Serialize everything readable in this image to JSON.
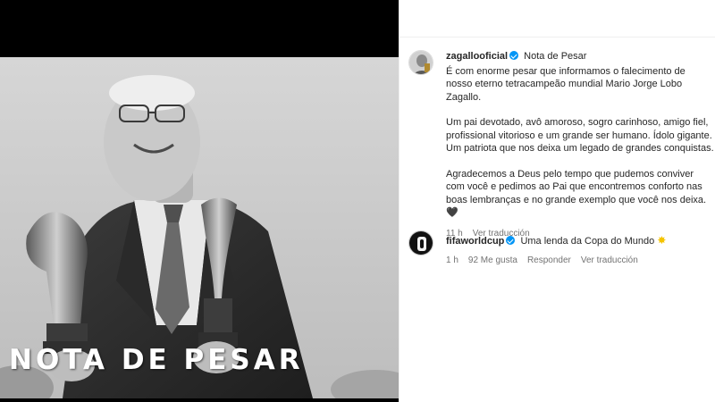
{
  "media": {
    "overlay_text": "NOTA DE PESAR"
  },
  "post": {
    "author": "zagallooficial",
    "title": "Nota de Pesar",
    "paragraphs": [
      "É com enorme pesar que informamos o falecimento de nosso eterno tetracampeão mundial Mario Jorge Lobo Zagallo.",
      "Um pai devotado, avô amoroso, sogro carinhoso, amigo fiel, profissional vitorioso e um grande ser humano. Ídolo gigante. Um patriota que nos deixa um legado de grandes conquistas.",
      "Agradecemos a Deus pelo tempo que pudemos conviver com você e pedimos ao Pai que encontremos conforto nas boas lembranças e no grande exemplo que você nos deixa."
    ],
    "emoji": "🖤",
    "time": "11 h",
    "translate": "Ver traducción"
  },
  "reply": {
    "author": "fifaworldcup",
    "text": "Uma lenda da Copa do Mundo",
    "emoji": "✸",
    "time": "1 h",
    "likes": "92 Me gusta",
    "reply_label": "Responder",
    "translate": "Ver traducción"
  },
  "colors": {
    "verified": "#0095f6",
    "meta_text": "#737373",
    "primary_text": "#262626"
  },
  "icons": {
    "verified": "verified-badge-icon",
    "heart": "black-heart-icon",
    "sparkle": "sparkle-icon"
  }
}
